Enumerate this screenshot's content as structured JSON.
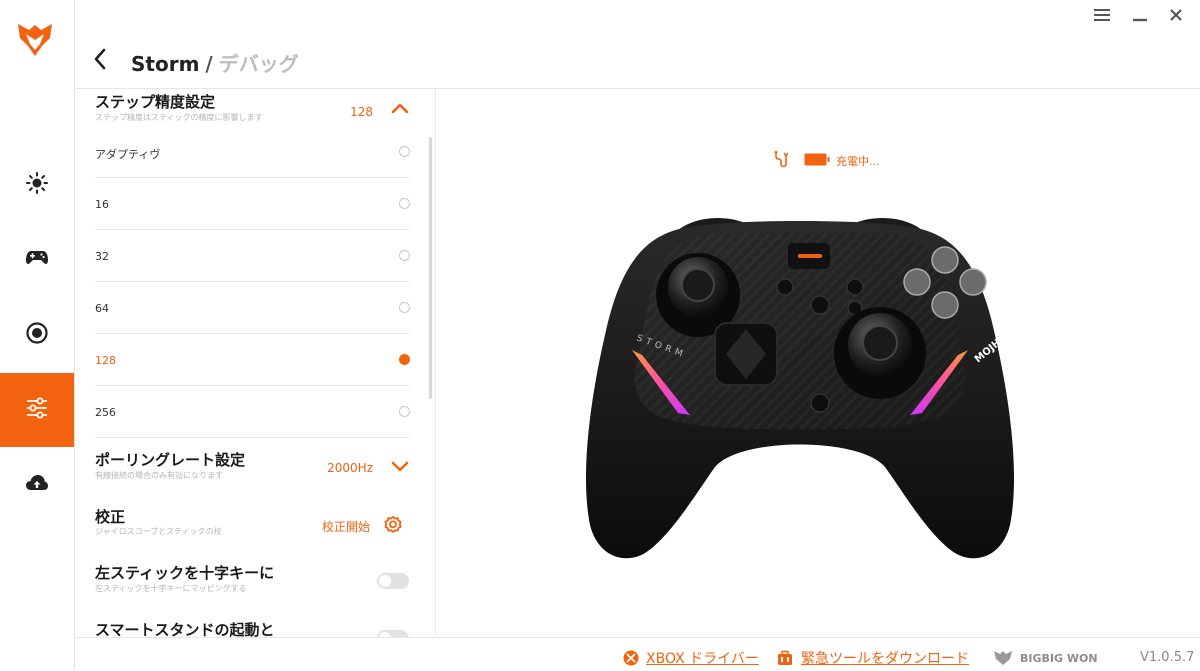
{
  "window": {
    "menu_icon": "hamburger-icon",
    "minimize_icon": "minimize-icon",
    "close_icon": "close-icon"
  },
  "header": {
    "device": "Storm",
    "separator": "/",
    "page": "デバッグ"
  },
  "sidebar": {
    "items": [
      {
        "icon": "brightness-icon",
        "active": false
      },
      {
        "icon": "gamepad-icon",
        "active": false
      },
      {
        "icon": "record-icon",
        "active": false
      },
      {
        "icon": "sliders-icon",
        "active": true
      },
      {
        "icon": "cloud-upload-icon",
        "active": false
      }
    ]
  },
  "settings": {
    "step_precision": {
      "title": "ステップ精度設定",
      "desc": "ステップ精度はスティックの精度に影響します",
      "value": "128",
      "options": [
        "アダプティヴ",
        "16",
        "32",
        "64",
        "128",
        "256"
      ],
      "selected": "128"
    },
    "polling_rate": {
      "title": "ポーリングレート設定",
      "desc": "有線接続の場合のみ有効になります",
      "value": "2000Hz"
    },
    "calibration": {
      "title": "校正",
      "desc": "ジャイロスコープとスティックの校",
      "action": "校正開始"
    },
    "left_stick_dpad": {
      "title": "左スティックを十字キーに",
      "desc": "左スティックを十字キーにマッピングする",
      "enabled": false
    },
    "smart_stand": {
      "title": "スマートスタンドの起動と",
      "enabled": false
    }
  },
  "status": {
    "charging": "充電中...",
    "accent": "#f2620f"
  },
  "device_image": {
    "brand_text": "MOJHON",
    "side_text": "STORM"
  },
  "footer": {
    "xbox_driver": "XBOX ドライバー",
    "emergency_tool": "緊急ツールをダウンロード",
    "brand": "BIGBIG WON",
    "version": "V1.0.5.7"
  }
}
